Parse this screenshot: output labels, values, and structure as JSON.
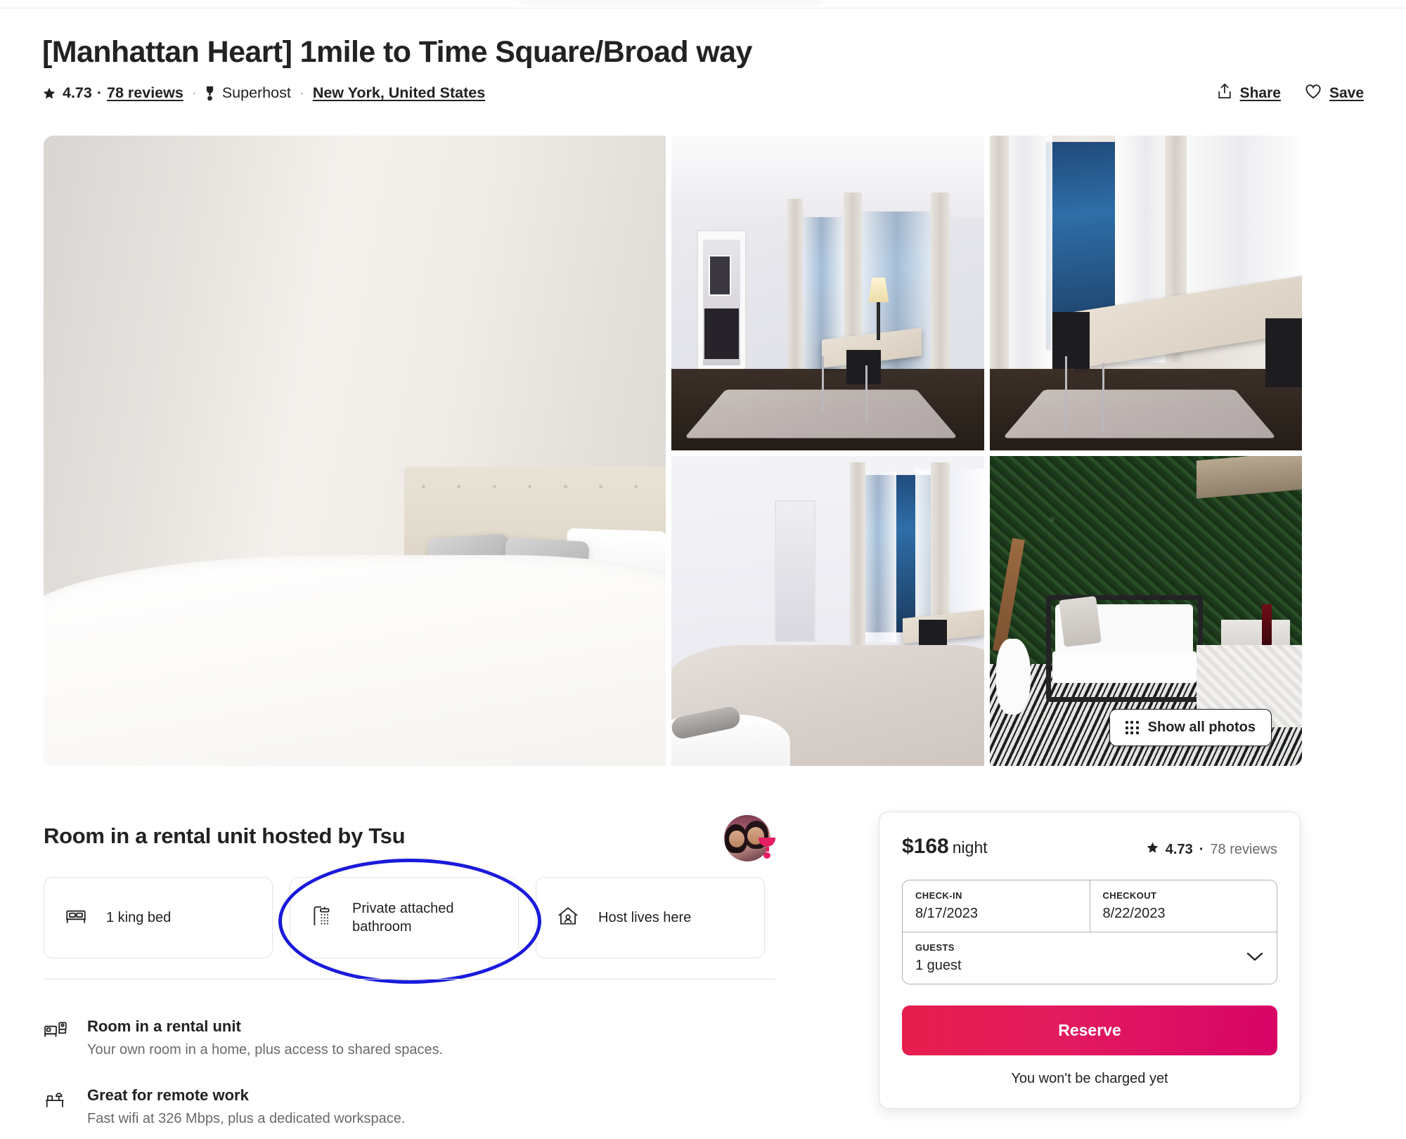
{
  "listing": {
    "title": "[Manhattan Heart] 1mile to Time Square/Broad way",
    "rating": "4.73",
    "dot": "·",
    "reviews": "78 reviews",
    "separator": "·",
    "superhost": "Superhost",
    "location": "New York, United States"
  },
  "actions": {
    "share": "Share",
    "save": "Save"
  },
  "gallery": {
    "show_all": "Show all photos",
    "photos": [
      {
        "name": "bedroom-king-bed",
        "alt": "Bedroom with white king bed and grey pillows"
      },
      {
        "name": "room-bay-window",
        "alt": "Room with bay window, desk and lamp"
      },
      {
        "name": "window-desk-view",
        "alt": "Sheer curtains with folding table by window"
      },
      {
        "name": "bedroom-bathroom-door",
        "alt": "Bedroom with bathroom door and bay window"
      },
      {
        "name": "patio-seating",
        "alt": "Patio with hedge wall, sofa, guitar and table"
      }
    ]
  },
  "host": {
    "heading": "Room in a rental unit hosted by Tsu",
    "avatar_name": "host-avatar",
    "badge": "superhost-badge"
  },
  "amenities": [
    {
      "icon": "bed-icon",
      "label": "1 king bed"
    },
    {
      "icon": "shower-icon",
      "label": "Private attached bathroom"
    },
    {
      "icon": "house-person-icon",
      "label": "Host lives here"
    }
  ],
  "features": [
    {
      "icon": "room-icon",
      "title": "Room in a rental unit",
      "desc": "Your own room in a home, plus access to shared spaces."
    },
    {
      "icon": "desk-icon",
      "title": "Great for remote work",
      "desc": "Fast wifi at 326 Mbps, plus a dedicated workspace."
    }
  ],
  "booking": {
    "price": "$168",
    "per": "night",
    "rating": "4.73",
    "dot": "·",
    "reviews": "78 reviews",
    "checkin_label": "CHECK-IN",
    "checkin_value": "8/17/2023",
    "checkout_label": "CHECKOUT",
    "checkout_value": "8/22/2023",
    "guests_label": "GUESTS",
    "guests_value": "1 guest",
    "reserve": "Reserve",
    "no_charge": "You won't be charged yet"
  },
  "annotation": {
    "name": "blue-ellipse-highlight",
    "color": "#1a1adc",
    "targets": "Private attached bathroom"
  },
  "colors": {
    "accent_pink": "#e31c5f",
    "text": "#222222",
    "muted": "#6a6a6a",
    "border": "#e4e4e4",
    "annotation_blue": "#1a1adc"
  }
}
